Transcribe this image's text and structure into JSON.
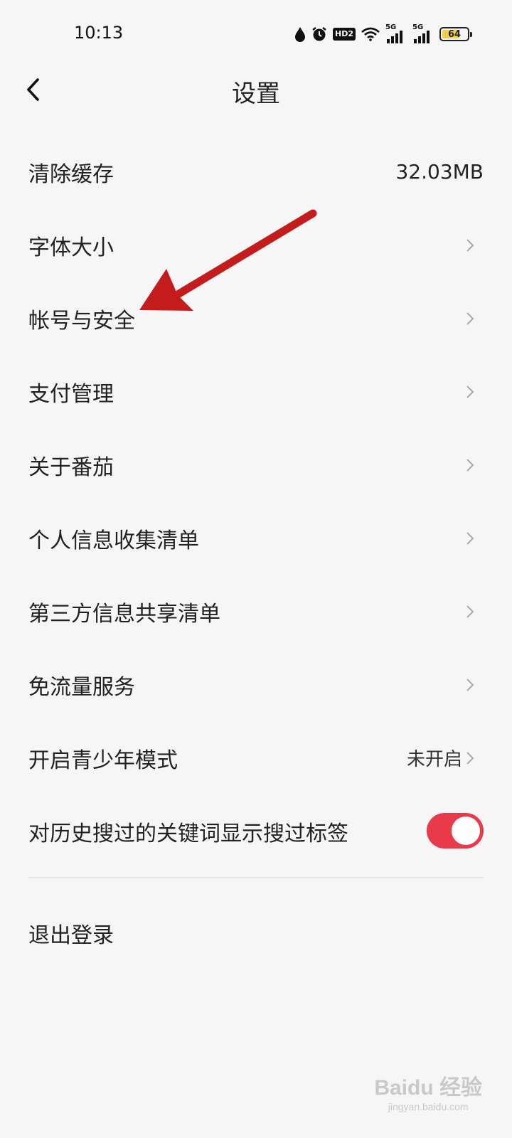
{
  "status_bar": {
    "time": "10:13",
    "hd_label": "HD2",
    "signal_1_label": "5G",
    "signal_2_label": "5G",
    "battery_level": "64"
  },
  "header": {
    "title": "设置",
    "back_icon": "chevron-left-icon"
  },
  "settings": {
    "items": [
      {
        "label": "清除缓存",
        "value": "32.03MB"
      },
      {
        "label": "字体大小"
      },
      {
        "label": "帐号与安全"
      },
      {
        "label": "支付管理"
      },
      {
        "label": "关于番茄"
      },
      {
        "label": "个人信息收集清单"
      },
      {
        "label": "第三方信息共享清单"
      },
      {
        "label": "免流量服务"
      },
      {
        "label": "开启青少年模式",
        "value": "未开启"
      },
      {
        "label": "对历史搜过的关键词显示搜过标签",
        "toggle_on": true
      }
    ]
  },
  "logout_label": "退出登录",
  "colors": {
    "accent": "#e83a4a",
    "background": "#f6f6f6",
    "annotation_arrow": "#c41c1c"
  },
  "watermark": {
    "main": "Baidu 经验",
    "sub": "jingyan.baidu.com"
  }
}
